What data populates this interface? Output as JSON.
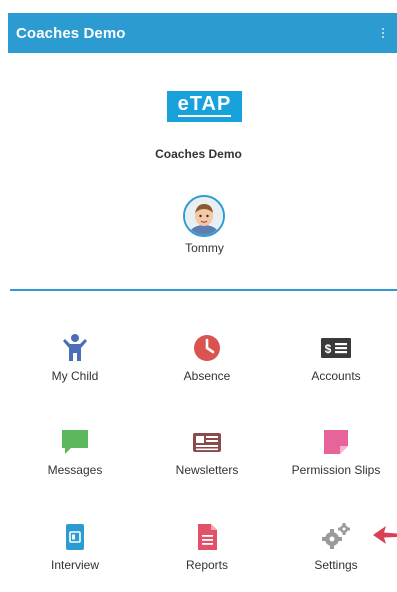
{
  "app_bar": {
    "title": "Coaches Demo"
  },
  "logo": {
    "text": "eTAP"
  },
  "org_name": "Coaches Demo",
  "child": {
    "name": "Tommy"
  },
  "menu": [
    {
      "label": "My Child",
      "icon": "child-icon",
      "color": "#4a6fb8"
    },
    {
      "label": "Absence",
      "icon": "clock-icon",
      "color": "#d9534f"
    },
    {
      "label": "Accounts",
      "icon": "money-icon",
      "color": "#3a3a3a"
    },
    {
      "label": "Messages",
      "icon": "chat-icon",
      "color": "#5cb85c"
    },
    {
      "label": "Newsletters",
      "icon": "newspaper-icon",
      "color": "#8b4a4a"
    },
    {
      "label": "Permission Slips",
      "icon": "sticky-note-icon",
      "color": "#e7649a"
    },
    {
      "label": "Interview",
      "icon": "calendar-icon",
      "color": "#2b9bd2"
    },
    {
      "label": "Reports",
      "icon": "document-icon",
      "color": "#e2506a"
    },
    {
      "label": "Settings",
      "icon": "gear-icon",
      "color": "#9a9a9a"
    }
  ],
  "colors": {
    "primary": "#2b9bd2",
    "background": "#ffffff",
    "pointer": "#d94055"
  }
}
